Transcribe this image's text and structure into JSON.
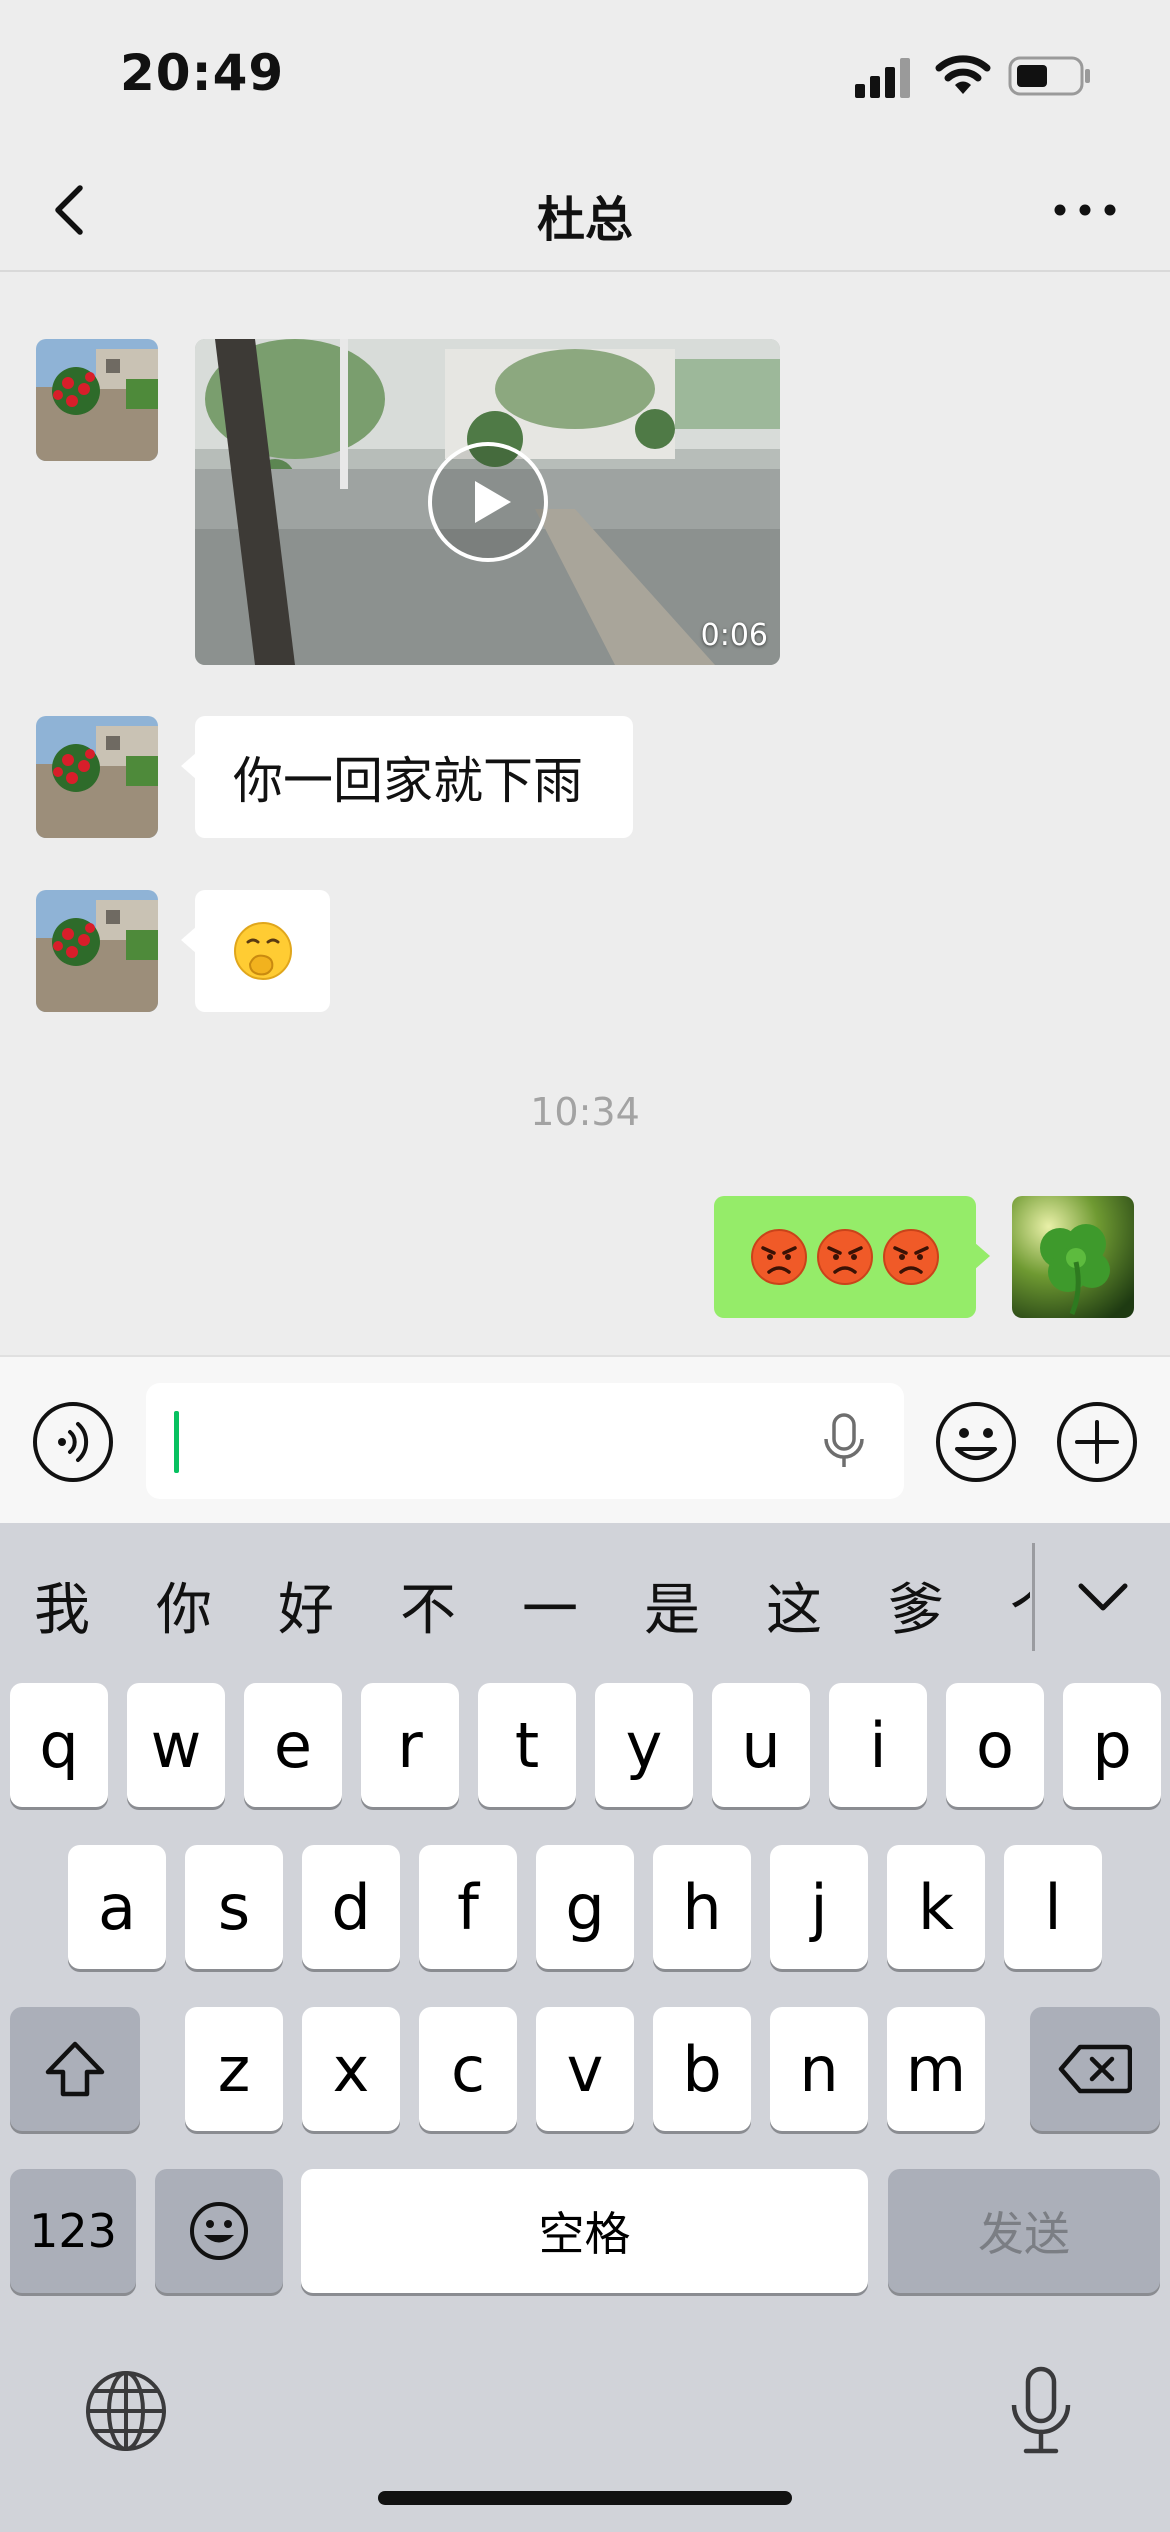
{
  "status_bar": {
    "time": "20:49"
  },
  "nav": {
    "title": "杜总",
    "back_icon": "chevron-left-icon",
    "more_icon": "more-dots-icon"
  },
  "messages": [
    {
      "type": "video",
      "from": "contact",
      "duration": "0:06"
    },
    {
      "type": "text",
      "from": "contact",
      "text": "你一回家就下雨"
    },
    {
      "type": "emoji",
      "from": "contact",
      "emoji": "🤭"
    },
    {
      "type": "timestamp",
      "text": "10:34"
    },
    {
      "type": "emoji",
      "from": "me",
      "emoji": [
        "😡",
        "😡",
        "😡"
      ]
    }
  ],
  "input_bar": {
    "value": "",
    "voice_icon": "voice-icon",
    "emoji_icon": "smile-icon",
    "plus_icon": "plus-icon"
  },
  "keyboard": {
    "candidates": [
      "我",
      "你",
      "好",
      "不",
      "一",
      "是",
      "这",
      "爹",
      "个"
    ],
    "row1": [
      "q",
      "w",
      "e",
      "r",
      "t",
      "y",
      "u",
      "i",
      "o",
      "p"
    ],
    "row2": [
      "a",
      "s",
      "d",
      "f",
      "g",
      "h",
      "j",
      "k",
      "l"
    ],
    "row3": [
      "z",
      "x",
      "c",
      "v",
      "b",
      "n",
      "m"
    ],
    "numbers_key": "123",
    "space_key": "空格",
    "send_key": "发送"
  },
  "colors": {
    "bubble_out": "#95EC69",
    "accent": "#07C160",
    "background": "#EDEDED"
  }
}
